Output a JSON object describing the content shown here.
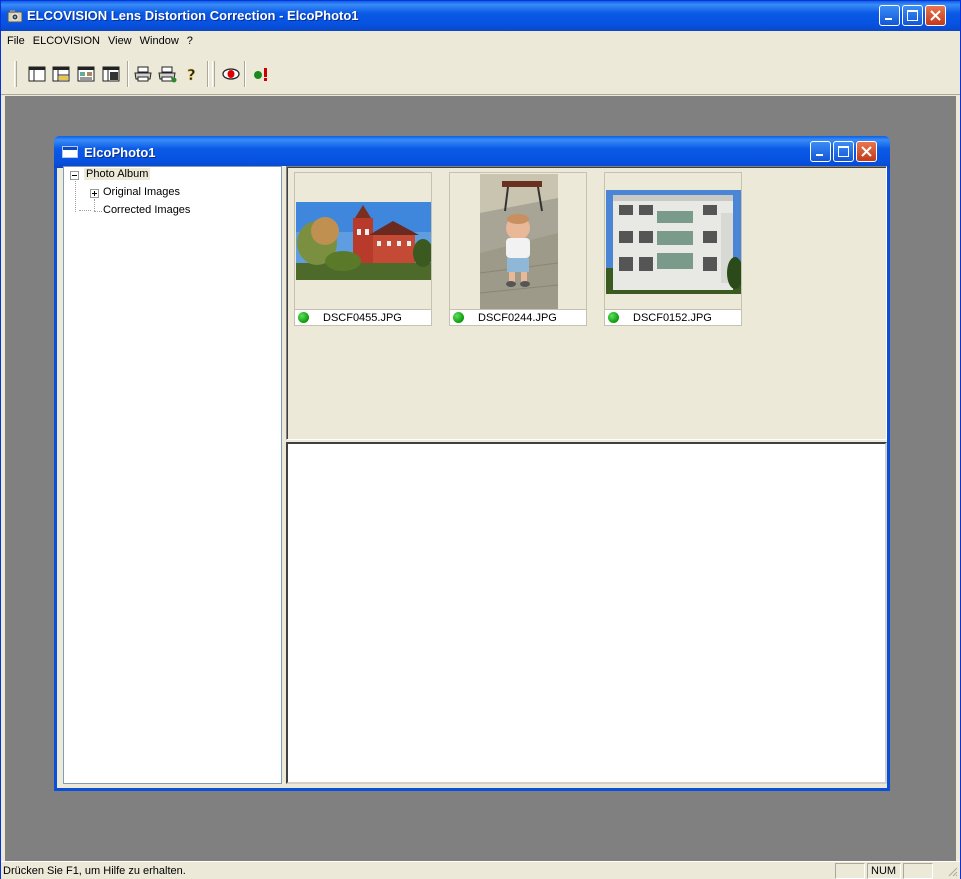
{
  "app": {
    "title": "ELCOVISION Lens Distortion Correction - ElcoPhoto1",
    "icon": "camera-app-icon"
  },
  "menubar": {
    "items": [
      "File",
      "ELCOVISION",
      "View",
      "Window",
      "?"
    ]
  },
  "toolbar": {
    "buttons": [
      {
        "name": "layout-tree-icon"
      },
      {
        "name": "layout-split-icon"
      },
      {
        "name": "layout-thumbnails-icon"
      },
      {
        "name": "layout-detail-icon"
      },
      {
        "name": "print-icon"
      },
      {
        "name": "print-preview-icon"
      },
      {
        "name": "help-icon"
      },
      {
        "name": "correction-eye-icon"
      },
      {
        "name": "run-correction-icon"
      }
    ]
  },
  "child_window": {
    "title": "ElcoPhoto1"
  },
  "tree": {
    "root": "Photo Album",
    "children": [
      "Original Images",
      "Corrected Images"
    ]
  },
  "thumbnails": [
    {
      "filename": "DSCF0455.JPG",
      "status": "green",
      "subject": "castle-photo"
    },
    {
      "filename": "DSCF0244.JPG",
      "status": "green",
      "subject": "child-photo"
    },
    {
      "filename": "DSCF0152.JPG",
      "status": "green",
      "subject": "building-photo"
    }
  ],
  "statusbar": {
    "message": "Drücken Sie F1, um Hilfe zu erhalten.",
    "num": "NUM"
  },
  "colors": {
    "titlebar_blue": "#0a5ae6",
    "mdi_gray": "#808080",
    "status_green": "#0a9a0a",
    "close_red": "#c2391b"
  }
}
